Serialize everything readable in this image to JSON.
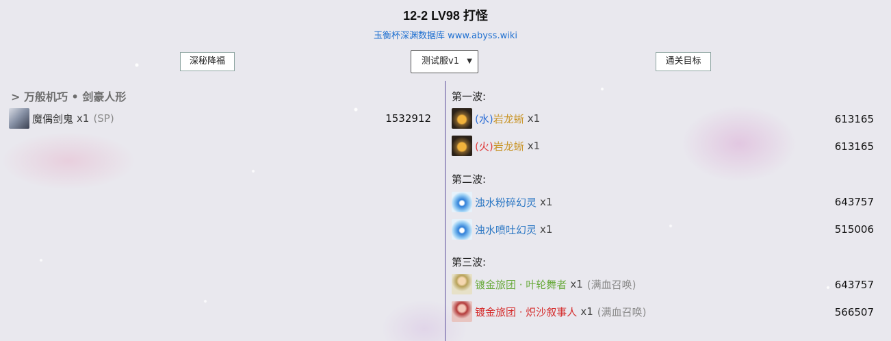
{
  "header": {
    "title": "12-2 LV98 打怪",
    "subtitle": "玉衡杯深渊数据库 www.abyss.wiki"
  },
  "toolbar": {
    "left_button": "深秘降福",
    "version_select": "测试服v1",
    "right_button": "通关目标"
  },
  "left": {
    "team_label": "> 万般机巧 • 剑豪人形",
    "enemies": [
      {
        "icon": "puppet-swordsman-icon",
        "name": "魔偶剑鬼",
        "count": "x1",
        "tag": "(SP)",
        "hp": "1532912"
      }
    ]
  },
  "right": {
    "waves": [
      {
        "label": "第一波:",
        "enemies": [
          {
            "icon": "lizard-icon",
            "prefix": "(水)",
            "name": "岩龙蜥",
            "count": "x1",
            "hp": "613165"
          },
          {
            "icon": "lizard-icon",
            "prefix": "(火)",
            "name": "岩龙蜥",
            "count": "x1",
            "hp": "613165"
          }
        ]
      },
      {
        "label": "第二波:",
        "enemies": [
          {
            "icon": "water-phantom-icon",
            "name": "浊水粉碎幻灵",
            "count": "x1",
            "hp": "643757"
          },
          {
            "icon": "water-phantom-icon",
            "name": "浊水喷吐幻灵",
            "count": "x1",
            "hp": "515006"
          }
        ]
      },
      {
        "label": "第三波:",
        "enemies": [
          {
            "icon": "dancer-icon",
            "name": "镀金旅团 · 叶轮舞者",
            "count": "x1",
            "tag": "(满血召唤)",
            "hp": "643757"
          },
          {
            "icon": "narrator-icon",
            "name": "镀金旅团 · 炽沙叙事人",
            "count": "x1",
            "tag": "(满血召唤)",
            "hp": "566507"
          }
        ]
      }
    ]
  }
}
